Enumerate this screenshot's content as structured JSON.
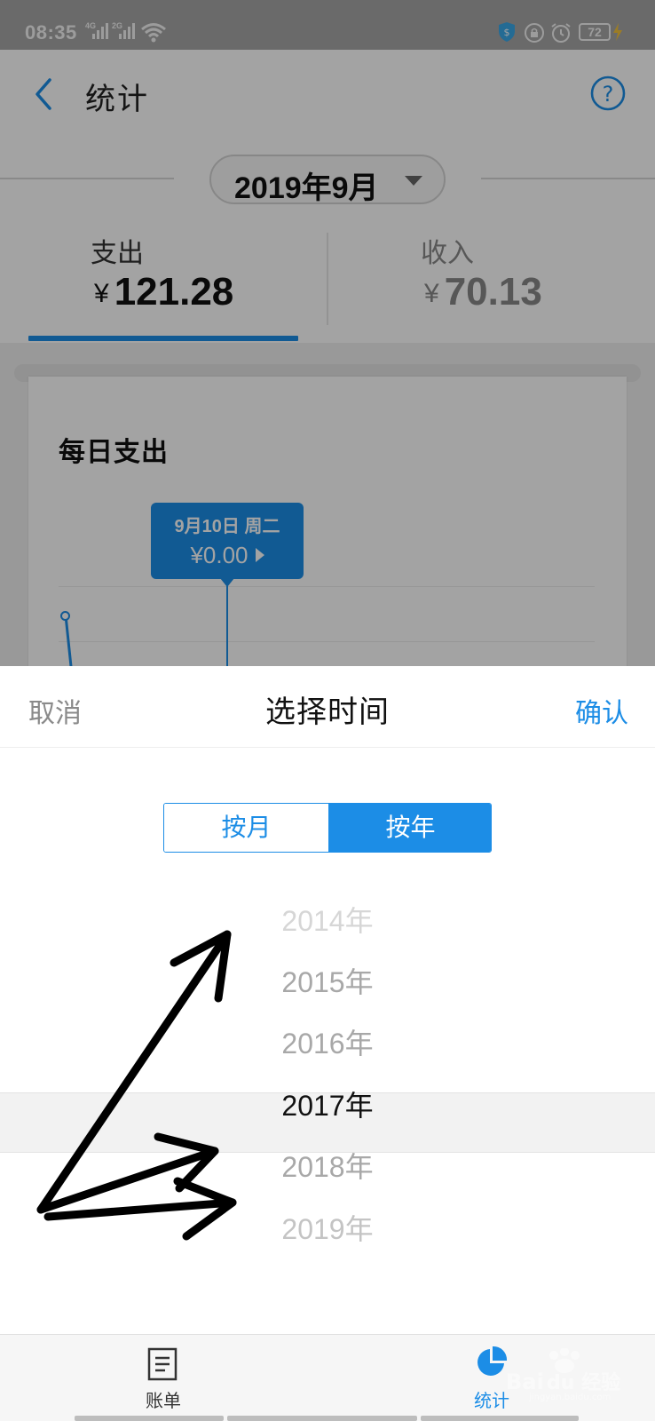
{
  "status_bar": {
    "time": "08:35",
    "signal1_label": "4G",
    "signal2_label": "2G",
    "battery": "72"
  },
  "header": {
    "title": "统计"
  },
  "background": {
    "month_selector": "2019年9月",
    "tabs": [
      {
        "label": "支出",
        "currency": "¥",
        "amount": "121.28",
        "active": true
      },
      {
        "label": "收入",
        "currency": "¥",
        "amount": "70.13",
        "active": false
      }
    ],
    "daily_card": {
      "title": "每日支出",
      "tooltip_date": "9月10日 周二",
      "tooltip_value": "¥0.00"
    }
  },
  "sheet": {
    "cancel": "取消",
    "title": "选择时间",
    "confirm": "确认",
    "modes": [
      "按月",
      "按年"
    ],
    "selected_mode": "按年",
    "years": [
      {
        "label": "2014年",
        "color": "#d6d6d6"
      },
      {
        "label": "2015年",
        "color": "#a8a8a8"
      },
      {
        "label": "2016年",
        "color": "#a8a8a8"
      },
      {
        "label": "2017年",
        "color": "#111111",
        "selected": true
      },
      {
        "label": "2018年",
        "color": "#a8a8a8"
      },
      {
        "label": "2019年",
        "color": "#c4c4c4"
      }
    ]
  },
  "bottom_nav": [
    {
      "label": "账单",
      "icon": "bill-list-icon"
    },
    {
      "label": "统计",
      "icon": "pie-chart-icon",
      "active": true
    }
  ],
  "colors": {
    "accent": "#1c8de6",
    "overlay": "rgba(0,0,0,0.36)"
  }
}
